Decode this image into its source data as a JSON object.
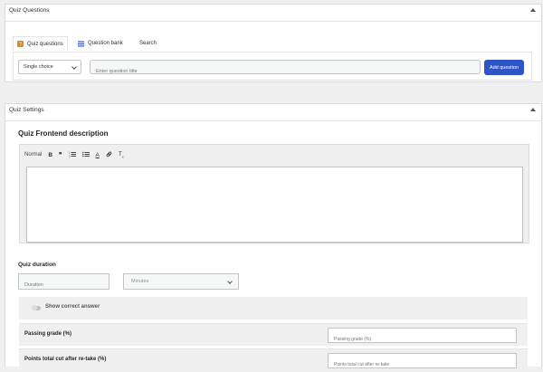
{
  "quiz_questions": {
    "title": "Quiz Questions",
    "tabs": [
      {
        "label": "Quiz questions",
        "icon": "question-icon",
        "active": true
      },
      {
        "label": "Question bank",
        "icon": "list-icon",
        "active": false
      },
      {
        "label": "Search",
        "active": false
      }
    ],
    "question_type": "Single choice",
    "question_placeholder": "Enter question title",
    "add_button": "Add question"
  },
  "quiz_settings": {
    "title": "Quiz Settings",
    "description_heading": "Quiz Frontend description",
    "editor": {
      "format": "Normal",
      "tools": [
        "bold-icon",
        "blockquote-icon",
        "ordered-list-icon",
        "bullet-list-icon",
        "text-color-icon",
        "link-icon",
        "clear-format-icon"
      ]
    },
    "duration": {
      "heading": "Quiz duration",
      "input_placeholder": "Duration",
      "unit": "Minutes"
    },
    "show_correct_answer": "Show correct answer",
    "passing_grade": {
      "label": "Passing grade (%)",
      "placeholder": "Passing grade (%)"
    },
    "points_cut": {
      "label": "Points total cut after re-take (%)",
      "placeholder": "Points total cut after re-take"
    }
  },
  "colors": {
    "accent": "#2f54c6",
    "quiz_icon": "#e08a1e",
    "bank_icon": "#2f54c6"
  }
}
